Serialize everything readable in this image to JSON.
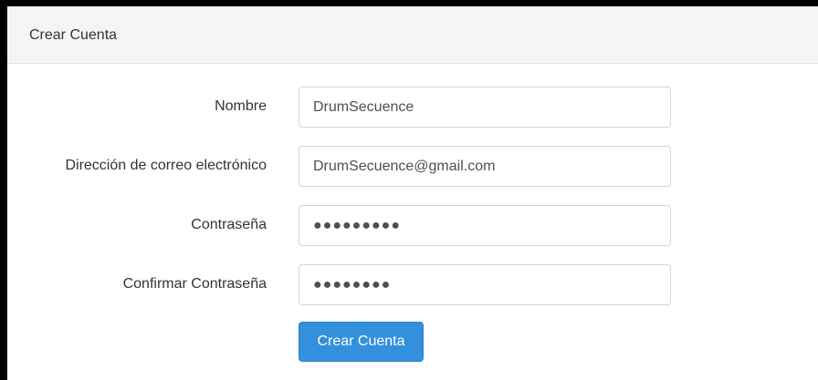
{
  "card": {
    "title": "Crear Cuenta"
  },
  "form": {
    "fields": [
      {
        "label": "Nombre",
        "value": "DrumSecuence",
        "type": "text"
      },
      {
        "label": "Dirección de correo electrónico",
        "value": "DrumSecuence@gmail.com",
        "type": "email"
      },
      {
        "label": "Contraseña",
        "value": "●●●●●●●●●",
        "type": "password"
      },
      {
        "label": "Confirmar Contraseña",
        "value": "●●●●●●●●",
        "type": "password"
      }
    ],
    "submit_label": "Crear Cuenta"
  },
  "colors": {
    "primary": "#3490dc",
    "heading_bg": "#f5f5f5",
    "text": "#333333"
  }
}
